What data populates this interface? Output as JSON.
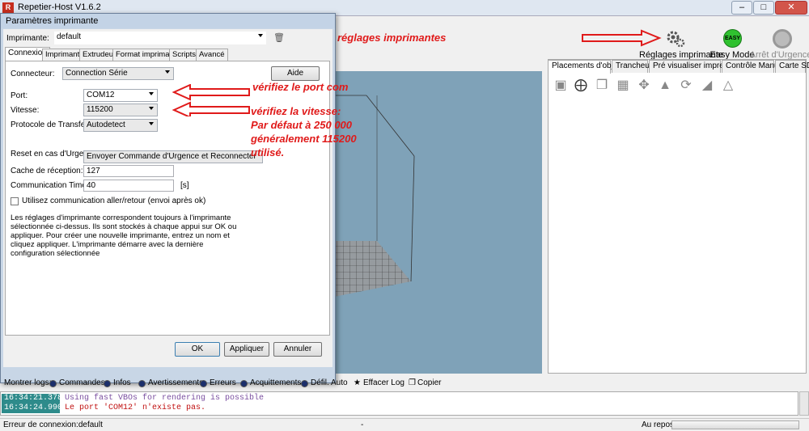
{
  "app": {
    "title": "Repetier-Host V1.6.2",
    "icon_letter": "R"
  },
  "window_controls": {
    "minimize": "–",
    "maximize": "□",
    "close": "✕"
  },
  "toolbar": {
    "annotation": "réglages imprimantes",
    "printer_settings_label": "Réglages imprimante",
    "easy_mode_label": "Easy Mode",
    "easy_badge": "EASY",
    "emergency_label": "Arrêt d'Urgence"
  },
  "right_tabs": [
    "Placements d'objets",
    "Trancheur",
    "Pré visualiser impression",
    "Contrôle Manuel",
    "Carte SD"
  ],
  "right_tools": [
    "save-icon",
    "add-icon",
    "copy-icon",
    "grid-icon",
    "center-icon",
    "scale-icon",
    "rotate-icon",
    "mirror-icon",
    "cut-icon"
  ],
  "dialog": {
    "title": "Paramètres imprimante",
    "printer_label": "Imprimante:",
    "printer_value": "default",
    "tabs": [
      "Connexion",
      "Imprimante",
      "Extrudeur",
      "Format imprimante",
      "Scripts",
      "Avancé"
    ],
    "connector_label": "Connecteur:",
    "connector_value": "Connection Série",
    "help_button": "Aide",
    "port_label": "Port:",
    "port_value": "COM12",
    "speed_label": "Vitesse:",
    "speed_value": "115200",
    "protocol_label": "Protocole de Transfert:",
    "protocol_value": "Autodetect",
    "reset_label": "Reset en cas d'Urgence",
    "reset_value": "Envoyer Commande d'Urgence et Reconnecter",
    "cache_label": "Cache de réception:",
    "cache_value": "127",
    "timeout_label": "Communication Timeout:",
    "timeout_value": "40",
    "timeout_unit": "[s]",
    "pingpong_label": "Utilisez communication aller/retour (envoi après ok)",
    "info_text": "Les réglages d'imprimante correspondent toujours à l'imprimante sélectionnée ci-dessus. Ils sont stockés à chaque appui sur OK ou appliquer. Pour créer une nouvelle imprimante, entrez un nom et cliquez appliquer. L'imprimante démarre avec la dernière configuration sélectionnée",
    "ok": "OK",
    "apply": "Appliquer",
    "cancel": "Annuler"
  },
  "annotations": {
    "port": "vérifiez le port com",
    "speed_1": "vérifiez la vitesse:",
    "speed_2": "Par défaut à 250 000",
    "speed_3": "généralement 115200",
    "speed_4": "utilisé."
  },
  "logbar": {
    "show_logs": "Montrer logs:",
    "options": [
      "Commandes",
      "Infos",
      "Avertissements",
      "Erreurs",
      "Acquittements",
      "Défil. Auto"
    ],
    "clear_log": "Effacer Log",
    "copy": "Copier"
  },
  "logs": [
    {
      "time": "16:34:21.378",
      "msg": "Using fast VBOs for rendering is possible",
      "color": "#7a4fa0"
    },
    {
      "time": "16:34:24.990",
      "msg": "Le port 'COM12' n'existe pas.",
      "color": "#c01010"
    }
  ],
  "status": {
    "left": "Erreur de connexion:default",
    "middle": "-",
    "right": "Au repos"
  }
}
